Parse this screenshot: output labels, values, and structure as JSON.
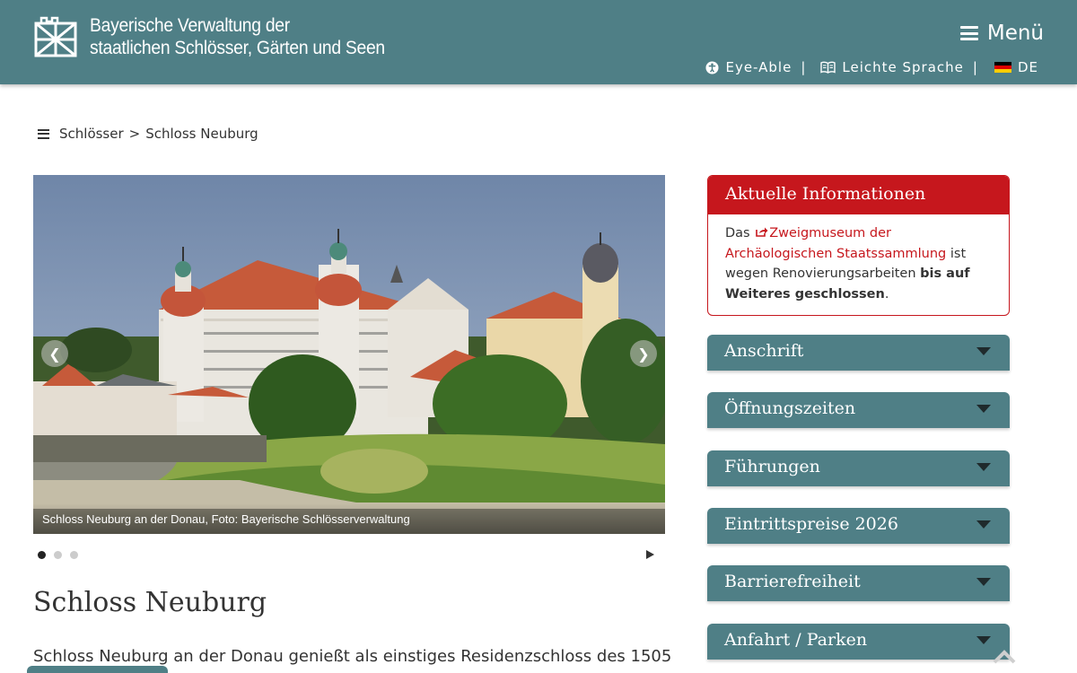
{
  "header": {
    "org_line1": "Bayerische Verwaltung der",
    "org_line2": "staatlichen Schlösser, Gärten und Seen",
    "menu_label": "Menü",
    "util": {
      "eye_able": "Eye-Able",
      "sep": "|",
      "leichte_sprache": "Leichte Sprache",
      "lang": "DE"
    }
  },
  "breadcrumb": {
    "parent": "Schlösser",
    "sep": ">",
    "current": "Schloss Neuburg"
  },
  "slider": {
    "caption": "Schloss Neuburg an der Donau, Foto: Bayerische Schlösserverwaltung",
    "prev_icon": "chevron-left-icon",
    "next_icon": "chevron-right-icon",
    "slide_count": 3,
    "active_slide": 1
  },
  "main": {
    "title": "Schloss Neuburg",
    "intro": "Schloss Neuburg an der Donau genießt als einstiges Residenzschloss des 1505"
  },
  "info_box": {
    "title": "Aktuelle Informationen",
    "text_before": "Das",
    "link": "Zweigmuseum der Archäologischen Staatssammlung",
    "text_middle": "ist wegen Renovierungsarbeiten",
    "text_bold": "bis auf Weiteres geschlossen",
    "text_end": "."
  },
  "accordion": [
    {
      "label": "Anschrift"
    },
    {
      "label": "Öffnungszeiten"
    },
    {
      "label": "Führungen"
    },
    {
      "label": "Eintrittspreise 2026"
    },
    {
      "label": "Barrierefreiheit"
    },
    {
      "label": "Anfahrt / Parken"
    }
  ],
  "colors": {
    "brand": "#4f7f86",
    "alert": "#c6171d"
  }
}
